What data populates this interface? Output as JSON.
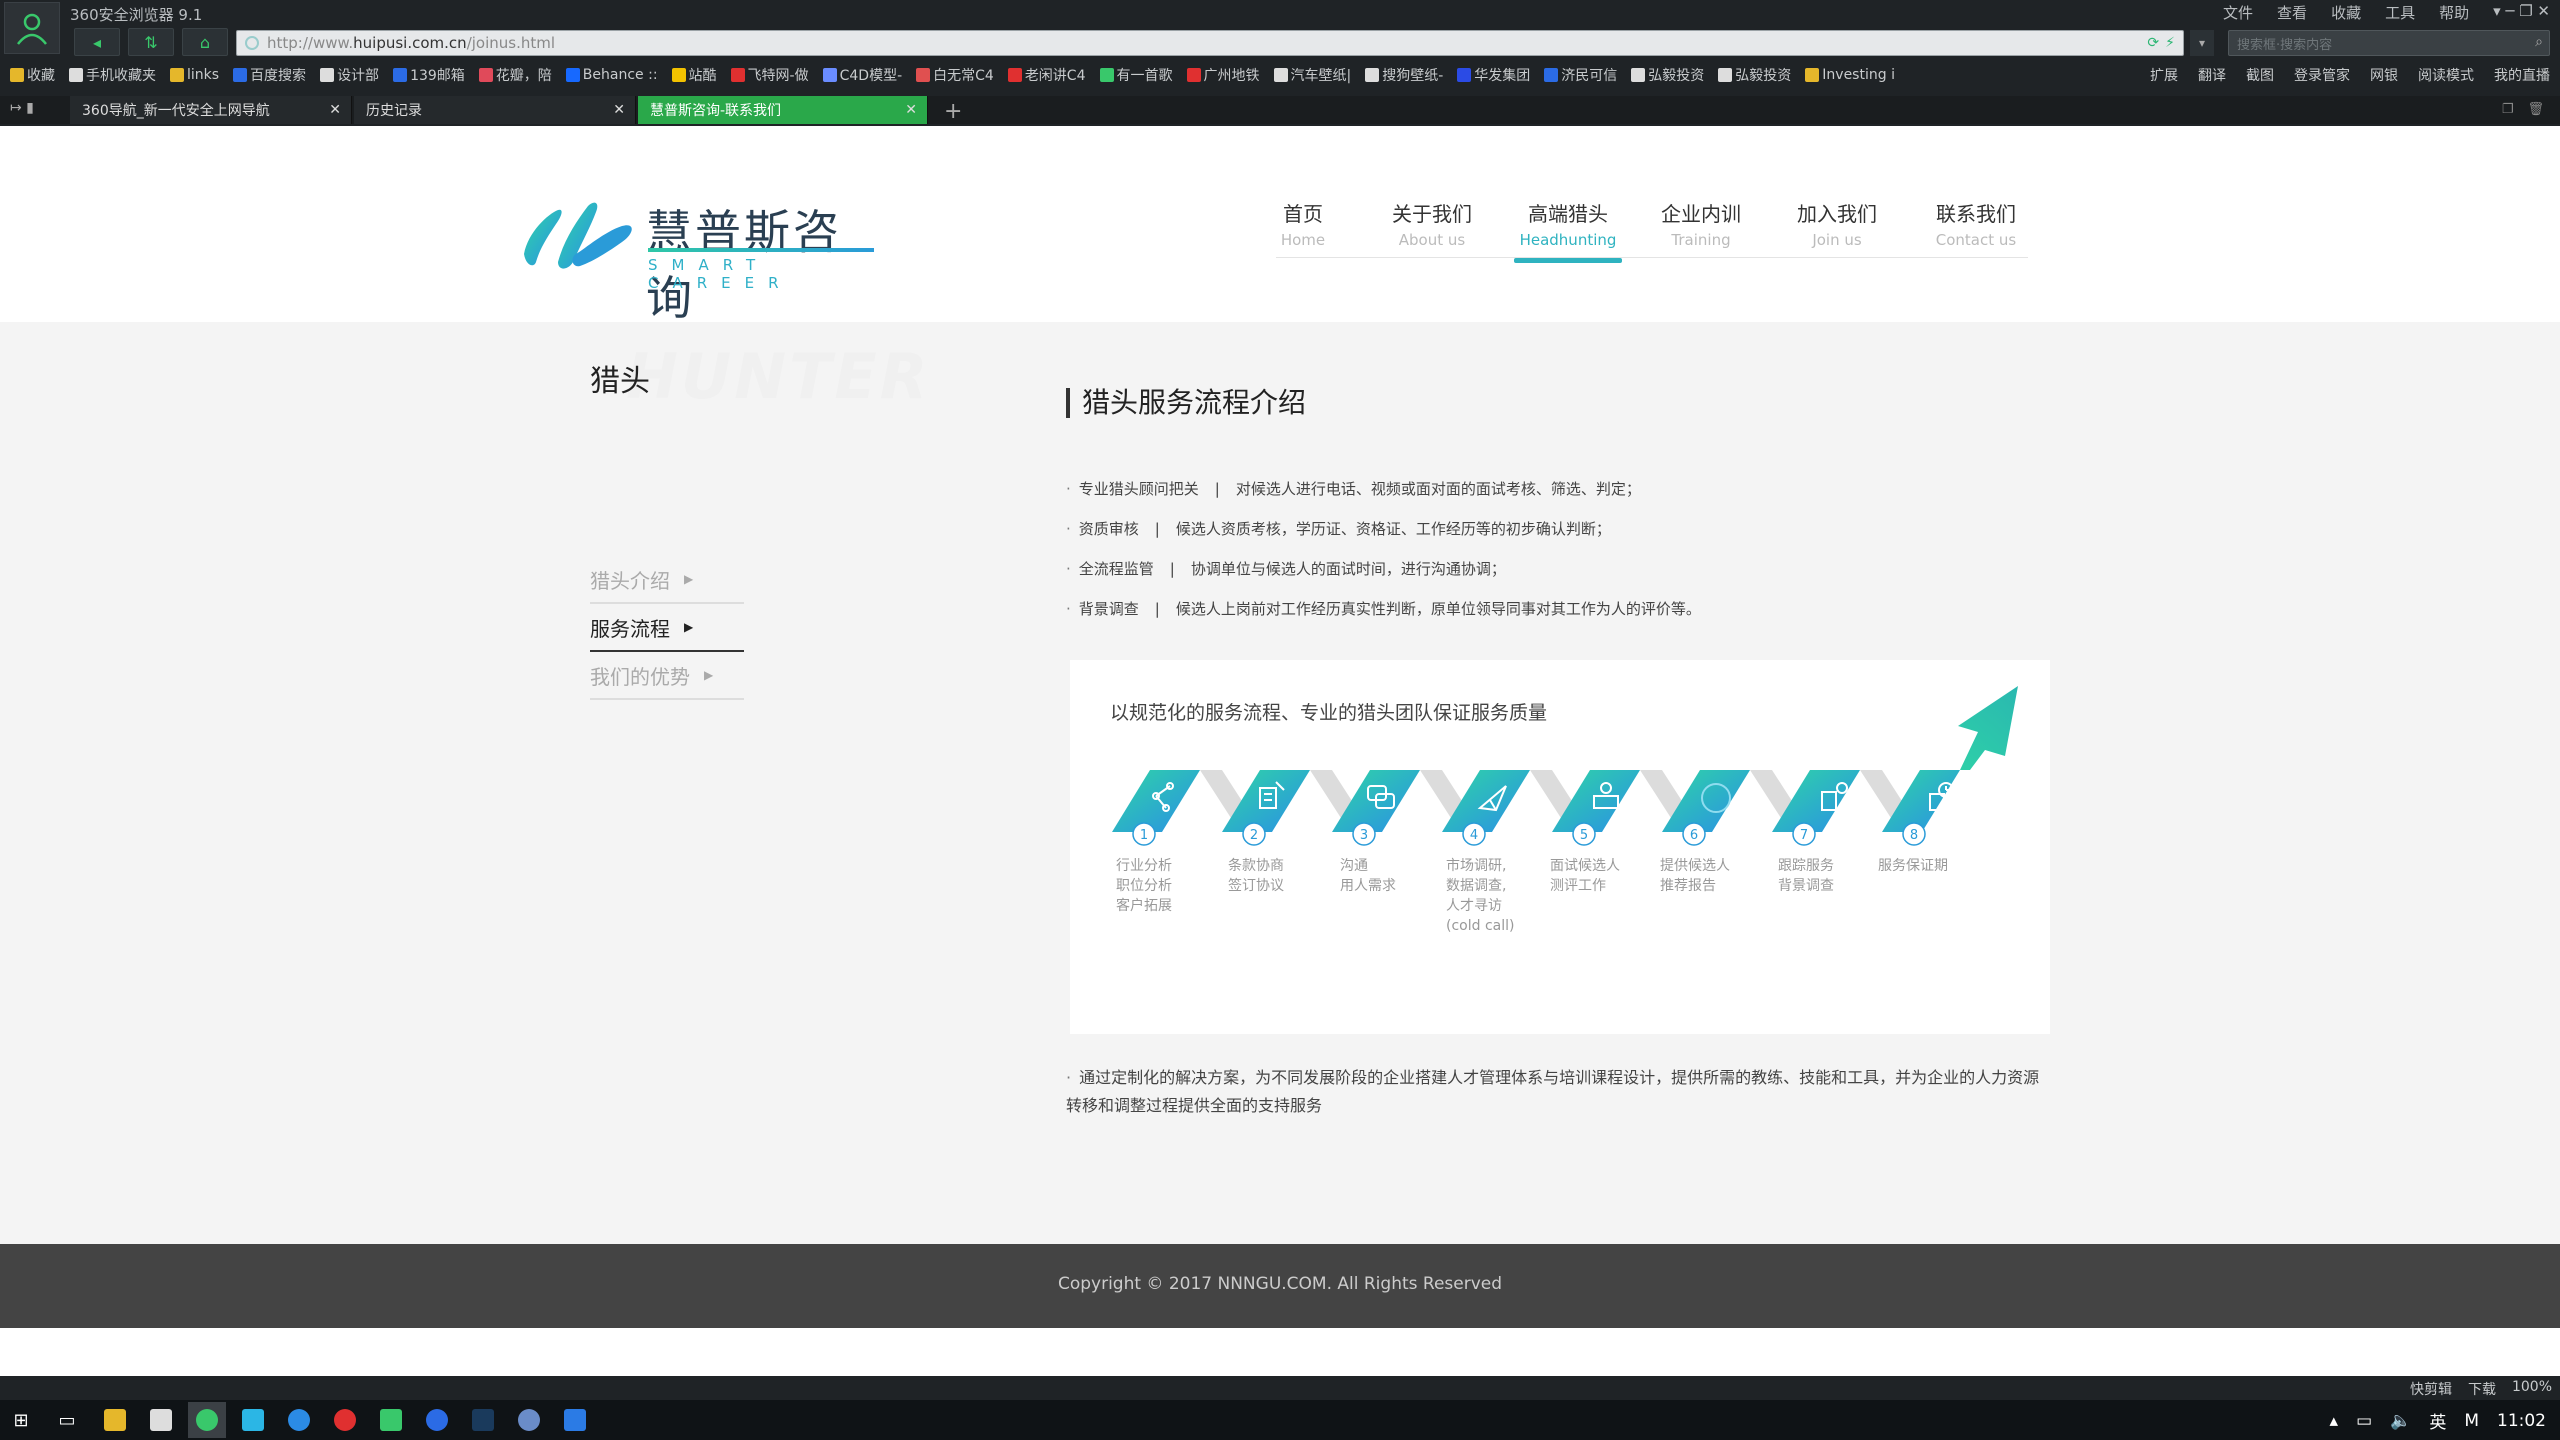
{
  "browser": {
    "title": "360安全浏览器 9.1",
    "menu": [
      "文件",
      "查看",
      "收藏",
      "工具",
      "帮助"
    ],
    "address": {
      "prefix": "http://www.",
      "domain": "huipusi.com.cn",
      "path": "/joinus.html"
    },
    "search_placeholder": "搜索框·搜索内容",
    "bookmarks": [
      "收藏",
      "手机收藏夹",
      "links",
      "百度搜索",
      "设计部",
      "139邮箱",
      "花瓣，陪",
      "Behance ::",
      "站酷",
      "飞特网-做",
      "C4D模型-",
      "白无常C4",
      "老闲讲C4",
      "有一首歌",
      "广州地铁",
      "汽车壁纸|",
      "搜狗壁纸-",
      "华发集团",
      "济民可信",
      "弘毅投资",
      "弘毅投资",
      "Investing i"
    ],
    "bookmarks_right": [
      "扩展",
      "翻译",
      "截图",
      "登录管家",
      "网银",
      "阅读模式",
      "我的直播"
    ],
    "tabs": [
      {
        "label": "360导航_新一代安全上网导航",
        "active": false
      },
      {
        "label": "历史记录",
        "active": false
      },
      {
        "label": "慧普斯咨询-联系我们",
        "active": true
      }
    ]
  },
  "site": {
    "logo_cn": "慧普斯咨询",
    "logo_en": "SMART CAREER",
    "nav": [
      {
        "cn": "首页",
        "en": "Home"
      },
      {
        "cn": "关于我们",
        "en": "About us"
      },
      {
        "cn": "高端猎头",
        "en": "Headhunting"
      },
      {
        "cn": "企业内训",
        "en": "Training"
      },
      {
        "cn": "加入我们",
        "en": "Join us"
      },
      {
        "cn": "联系我们",
        "en": "Contact us"
      }
    ],
    "active_nav": "高端猎头"
  },
  "sidebar": {
    "title": "猎头",
    "ghost": "HUNTER",
    "items": [
      {
        "label": "猎头介绍",
        "active": false
      },
      {
        "label": "服务流程",
        "active": true
      },
      {
        "label": "我们的优势",
        "active": false
      }
    ]
  },
  "content": {
    "title": "猎头服务流程介绍",
    "bullets": [
      {
        "key": "专业猎头顾问把关",
        "text": "对候选人进行电话、视频或面对面的面试考核、筛选、判定；"
      },
      {
        "key": "资质审核",
        "text": "候选人资质考核，学历证、资格证、工作经历等的初步确认判断；"
      },
      {
        "key": "全流程监管",
        "text": "协调单位与候选人的面试时间，进行沟通协调；"
      },
      {
        "key": "背景调查",
        "text": "候选人上岗前对工作经历真实性判断，原单位领导同事对其工作为人的评价等。"
      }
    ],
    "process_title": "以规范化的服务流程、专业的猎头团队保证服务质量",
    "steps": [
      {
        "num": "1",
        "lines": [
          "行业分析",
          "职位分析",
          "客户拓展"
        ]
      },
      {
        "num": "2",
        "lines": [
          "条款协商",
          "签订协议"
        ]
      },
      {
        "num": "3",
        "lines": [
          "沟通",
          "用人需求"
        ]
      },
      {
        "num": "4",
        "lines": [
          "市场调研,",
          "数据调查,",
          "人才寻访",
          "(cold call)"
        ]
      },
      {
        "num": "5",
        "lines": [
          "面试候选人",
          "测评工作"
        ]
      },
      {
        "num": "6",
        "lines": [
          "提供候选人",
          "推荐报告"
        ]
      },
      {
        "num": "7",
        "lines": [
          "跟踪服务",
          "背景调查"
        ]
      },
      {
        "num": "8",
        "lines": [
          "服务保证期"
        ]
      }
    ],
    "outro": "通过定制化的解决方案，为不同发展阶段的企业搭建人才管理体系与培训课程设计，提供所需的教练、技能和工具，并为企业的人力资源转移和调整过程提供全面的支持服务"
  },
  "footer": {
    "copyright": "Copyright © 2017 NNNGU.COM. All Rights Reserved"
  },
  "statusbar": [
    "快剪辑",
    "下载",
    "100%"
  ],
  "taskbar": {
    "lang": "英",
    "time": "11:02"
  },
  "colors": {
    "accent": "#2fb3c0",
    "gradient_start": "#2fd5a6",
    "gradient_end": "#2a8fe6"
  }
}
